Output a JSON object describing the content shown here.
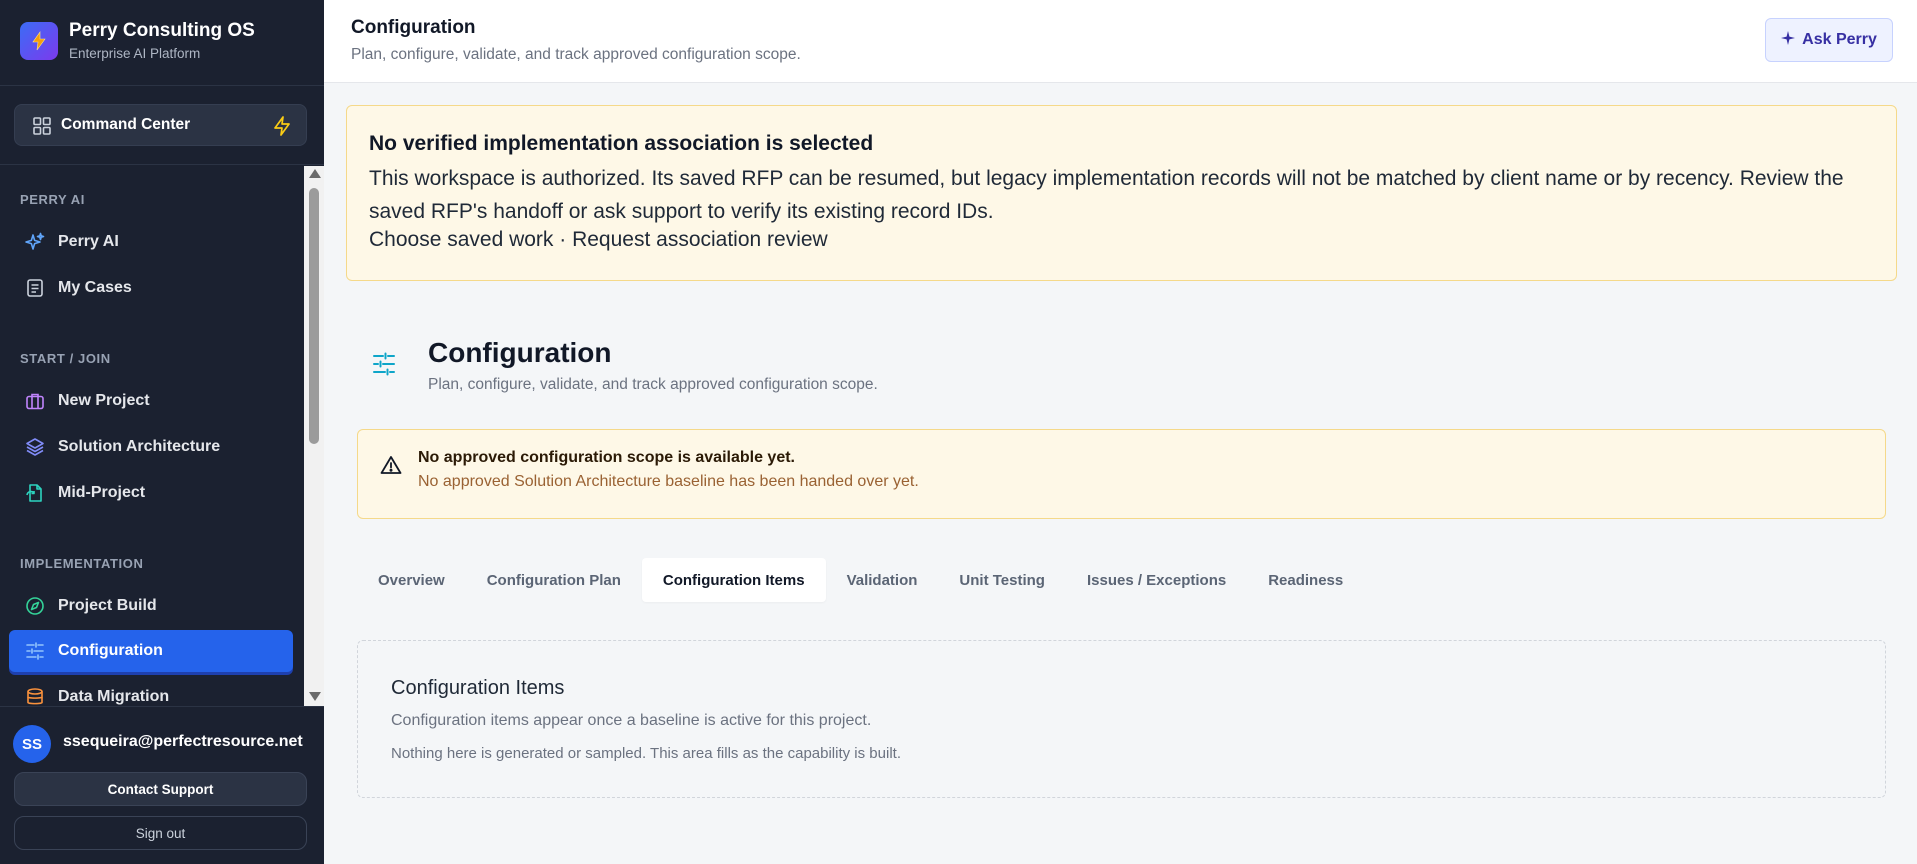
{
  "brand": {
    "name": "Perry Consulting OS",
    "subtitle": "Enterprise AI Platform",
    "logo_icon": "bolt-icon"
  },
  "command_center": {
    "label": "Command Center",
    "icon": "grid-icon",
    "action_icon": "bolt-icon"
  },
  "sidebar": {
    "sections": [
      {
        "title": "PERRY AI",
        "items": [
          {
            "label": "Perry AI",
            "icon": "sparkles-icon"
          },
          {
            "label": "My Cases",
            "icon": "document-icon"
          }
        ]
      },
      {
        "title": "START / JOIN",
        "items": [
          {
            "label": "New Project",
            "icon": "briefcase-icon"
          },
          {
            "label": "Solution Architecture",
            "icon": "layers-icon"
          },
          {
            "label": "Mid-Project",
            "icon": "file-sync-icon"
          }
        ]
      },
      {
        "title": "IMPLEMENTATION",
        "items": [
          {
            "label": "Project Build",
            "icon": "compass-icon"
          },
          {
            "label": "Configuration",
            "icon": "sliders-icon",
            "active": true
          },
          {
            "label": "Data Migration",
            "icon": "database-icon"
          }
        ]
      }
    ]
  },
  "user": {
    "initials": "SS",
    "email": "ssequeira@perfectresource.net",
    "support_label": "Contact Support",
    "signout_label": "Sign out"
  },
  "header": {
    "title": "Configuration",
    "subtitle": "Plan, configure, validate, and track approved configuration scope.",
    "ask_label": "Ask Perry"
  },
  "association_alert": {
    "title": "No verified implementation association is selected",
    "body": "This workspace is authorized. Its saved RFP can be resumed, but legacy implementation records will not be matched by client name or by recency. Review the saved RFP's handoff or ask support to verify its existing record IDs.",
    "links": "Choose saved work · Request association review"
  },
  "page": {
    "title": "Configuration",
    "subtitle": "Plan, configure, validate, and track approved configuration scope.",
    "icon": "sliders-icon"
  },
  "scope_alert": {
    "title": "No approved configuration scope is available yet.",
    "text": "No approved Solution Architecture baseline has been handed over yet.",
    "icon": "warning-icon"
  },
  "tabs": [
    {
      "label": "Overview"
    },
    {
      "label": "Configuration Plan"
    },
    {
      "label": "Configuration Items",
      "active": true
    },
    {
      "label": "Validation"
    },
    {
      "label": "Unit Testing"
    },
    {
      "label": "Issues / Exceptions"
    },
    {
      "label": "Readiness"
    }
  ],
  "panel": {
    "title": "Configuration Items",
    "text1": "Configuration items appear once a baseline is active for this project.",
    "text2": "Nothing here is generated or sampled. This area fills as the capability is built."
  },
  "colors": {
    "sidebar_bg": "#1b2130",
    "accent": "#2563eb",
    "warning_bg": "#fef8e7",
    "warning_border": "#f5d98a"
  }
}
